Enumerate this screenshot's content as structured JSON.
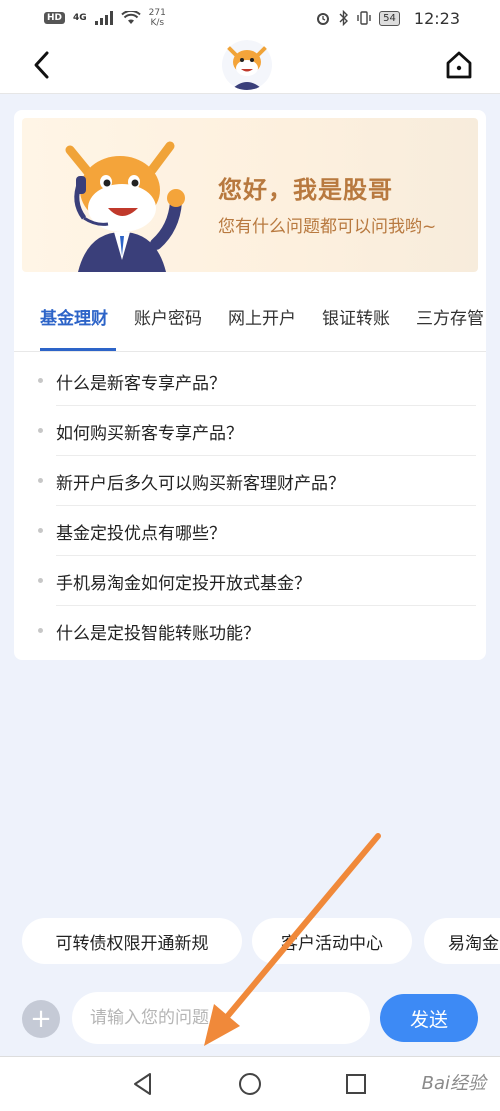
{
  "status_bar": {
    "hd": "HD",
    "signal": "4G",
    "net_speed_value": "271",
    "net_speed_unit": "K/s",
    "battery": "54",
    "time": "12:23"
  },
  "header": {
    "back_icon": "back-chevron-icon",
    "home_icon": "home-icon"
  },
  "banner": {
    "title": "您好，我是股哥",
    "subtitle": "您有什么问题都可以问我哟~"
  },
  "tabs": [
    {
      "label": "基金理财",
      "active": true
    },
    {
      "label": "账户密码",
      "active": false
    },
    {
      "label": "网上开户",
      "active": false
    },
    {
      "label": "银证转账",
      "active": false
    },
    {
      "label": "三方存管",
      "active": false
    }
  ],
  "questions": [
    "什么是新客专享产品？",
    "如何购买新客专享产品？",
    "新开户后多久可以购买新客理财产品？",
    "基金定投优点有哪些？",
    "手机易淘金如何定投开放式基金？",
    "什么是定投智能转账功能？"
  ],
  "chips": [
    "可转债权限开通新规",
    "客户活动中心",
    "易淘金"
  ],
  "input": {
    "placeholder": "请输入您的问题",
    "send_label": "发送",
    "plus": "+"
  },
  "watermark": "Bai经验",
  "colors": {
    "accent": "#2d64c8",
    "send_button": "#3d8af5",
    "banner_text": "#b8793f",
    "arrow": "#f0893a"
  }
}
